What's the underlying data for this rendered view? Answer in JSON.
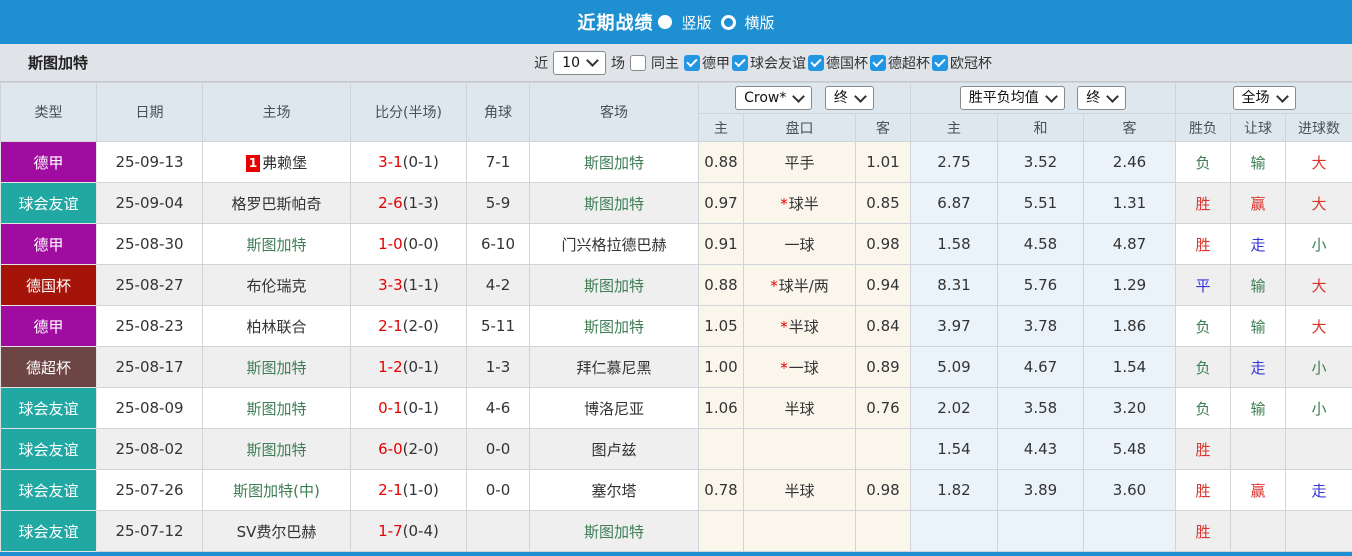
{
  "topbar": {
    "title": "近期战绩",
    "options": [
      {
        "label": "竖版",
        "selected": true
      },
      {
        "label": "横版",
        "selected": false
      }
    ]
  },
  "filterbar": {
    "team": "斯图加特",
    "near_label": "近",
    "count_value": "10",
    "games_label": "场",
    "same_venue": {
      "label": "同主",
      "checked": false
    },
    "leagues": [
      {
        "label": "德甲",
        "checked": true
      },
      {
        "label": "球会友谊",
        "checked": true
      },
      {
        "label": "德国杯",
        "checked": true
      },
      {
        "label": "德超杯",
        "checked": true
      },
      {
        "label": "欧冠杯",
        "checked": true
      }
    ]
  },
  "table": {
    "header": {
      "left": [
        "类型",
        "日期",
        "主场",
        "比分(半场)",
        "角球",
        "客场"
      ],
      "sub": [
        "主",
        "盘口",
        "客",
        "主",
        "和",
        "客",
        "胜负",
        "让球",
        "进球数"
      ]
    },
    "dropdowns": {
      "bookmaker": "Crow*",
      "final1": "终",
      "avg": "胜平负均值",
      "final2": "终",
      "scope": "全场"
    },
    "rows": [
      {
        "type": "德甲",
        "date": "25-09-13",
        "home": {
          "text": "弗赖堡",
          "self": false,
          "badge": "1"
        },
        "score": {
          "ft": "3-1",
          "ht": "(0-1)"
        },
        "corner": "7-1",
        "away": {
          "text": "斯图加特",
          "self": true
        },
        "odds": {
          "h": "0.88",
          "line": "平手",
          "star": false,
          "a": "1.01"
        },
        "avg": {
          "h": "2.75",
          "d": "3.52",
          "a": "2.46"
        },
        "res": [
          {
            "t": "负",
            "c": "green"
          },
          {
            "t": "输",
            "c": "green"
          },
          {
            "t": "大",
            "c": "red"
          }
        ]
      },
      {
        "type": "球会友谊",
        "date": "25-09-04",
        "home": {
          "text": "格罗巴斯帕奇",
          "self": false
        },
        "score": {
          "ft": "2-6",
          "ht": "(1-3)"
        },
        "corner": "5-9",
        "away": {
          "text": "斯图加特",
          "self": true
        },
        "odds": {
          "h": "0.97",
          "line": "球半",
          "star": true,
          "a": "0.85"
        },
        "avg": {
          "h": "6.87",
          "d": "5.51",
          "a": "1.31"
        },
        "res": [
          {
            "t": "胜",
            "c": "red"
          },
          {
            "t": "赢",
            "c": "red"
          },
          {
            "t": "大",
            "c": "red"
          }
        ]
      },
      {
        "type": "德甲",
        "date": "25-08-30",
        "home": {
          "text": "斯图加特",
          "self": true
        },
        "score": {
          "ft": "1-0",
          "ht": "(0-0)"
        },
        "corner": "6-10",
        "away": {
          "text": "门兴格拉德巴赫",
          "self": false
        },
        "odds": {
          "h": "0.91",
          "line": "一球",
          "star": false,
          "a": "0.98"
        },
        "avg": {
          "h": "1.58",
          "d": "4.58",
          "a": "4.87"
        },
        "res": [
          {
            "t": "胜",
            "c": "red"
          },
          {
            "t": "走",
            "c": "blue"
          },
          {
            "t": "小",
            "c": "green"
          }
        ]
      },
      {
        "type": "德国杯",
        "date": "25-08-27",
        "home": {
          "text": "布伦瑞克",
          "self": false
        },
        "score": {
          "ft": "3-3",
          "ht": "(1-1)"
        },
        "corner": "4-2",
        "away": {
          "text": "斯图加特",
          "self": true
        },
        "odds": {
          "h": "0.88",
          "line": "球半/两",
          "star": true,
          "a": "0.94"
        },
        "avg": {
          "h": "8.31",
          "d": "5.76",
          "a": "1.29"
        },
        "res": [
          {
            "t": "平",
            "c": "blue"
          },
          {
            "t": "输",
            "c": "green"
          },
          {
            "t": "大",
            "c": "red"
          }
        ]
      },
      {
        "type": "德甲",
        "date": "25-08-23",
        "home": {
          "text": "柏林联合",
          "self": false
        },
        "score": {
          "ft": "2-1",
          "ht": "(2-0)"
        },
        "corner": "5-11",
        "away": {
          "text": "斯图加特",
          "self": true
        },
        "odds": {
          "h": "1.05",
          "line": "半球",
          "star": true,
          "a": "0.84"
        },
        "avg": {
          "h": "3.97",
          "d": "3.78",
          "a": "1.86"
        },
        "res": [
          {
            "t": "负",
            "c": "green"
          },
          {
            "t": "输",
            "c": "green"
          },
          {
            "t": "大",
            "c": "red"
          }
        ]
      },
      {
        "type": "德超杯",
        "date": "25-08-17",
        "home": {
          "text": "斯图加特",
          "self": true
        },
        "score": {
          "ft": "1-2",
          "ht": "(0-1)"
        },
        "corner": "1-3",
        "away": {
          "text": "拜仁慕尼黑",
          "self": false
        },
        "odds": {
          "h": "1.00",
          "line": "一球",
          "star": true,
          "a": "0.89"
        },
        "avg": {
          "h": "5.09",
          "d": "4.67",
          "a": "1.54"
        },
        "res": [
          {
            "t": "负",
            "c": "green"
          },
          {
            "t": "走",
            "c": "blue"
          },
          {
            "t": "小",
            "c": "green"
          }
        ]
      },
      {
        "type": "球会友谊",
        "date": "25-08-09",
        "home": {
          "text": "斯图加特",
          "self": true
        },
        "score": {
          "ft": "0-1",
          "ht": "(0-1)"
        },
        "corner": "4-6",
        "away": {
          "text": "博洛尼亚",
          "self": false
        },
        "odds": {
          "h": "1.06",
          "line": "半球",
          "star": false,
          "a": "0.76"
        },
        "avg": {
          "h": "2.02",
          "d": "3.58",
          "a": "3.20"
        },
        "res": [
          {
            "t": "负",
            "c": "green"
          },
          {
            "t": "输",
            "c": "green"
          },
          {
            "t": "小",
            "c": "green"
          }
        ]
      },
      {
        "type": "球会友谊",
        "date": "25-08-02",
        "home": {
          "text": "斯图加特",
          "self": true
        },
        "score": {
          "ft": "6-0",
          "ht": "(2-0)"
        },
        "corner": "0-0",
        "away": {
          "text": "图卢兹",
          "self": false
        },
        "odds": {
          "h": "",
          "line": "",
          "star": false,
          "a": ""
        },
        "avg": {
          "h": "1.54",
          "d": "4.43",
          "a": "5.48"
        },
        "res": [
          {
            "t": "胜",
            "c": "red"
          },
          {
            "t": "",
            "c": ""
          },
          {
            "t": "",
            "c": ""
          }
        ]
      },
      {
        "type": "球会友谊",
        "date": "25-07-26",
        "home": {
          "text": "斯图加特(中)",
          "self": true
        },
        "score": {
          "ft": "2-1",
          "ht": "(1-0)"
        },
        "corner": "0-0",
        "away": {
          "text": "塞尔塔",
          "self": false
        },
        "odds": {
          "h": "0.78",
          "line": "半球",
          "star": false,
          "a": "0.98"
        },
        "avg": {
          "h": "1.82",
          "d": "3.89",
          "a": "3.60"
        },
        "res": [
          {
            "t": "胜",
            "c": "red"
          },
          {
            "t": "赢",
            "c": "red"
          },
          {
            "t": "走",
            "c": "blue"
          }
        ]
      },
      {
        "type": "球会友谊",
        "date": "25-07-12",
        "home": {
          "text": "SV费尔巴赫",
          "self": false
        },
        "score": {
          "ft": "1-7",
          "ht": "(0-4)"
        },
        "corner": "",
        "away": {
          "text": "斯图加特",
          "self": true
        },
        "odds": {
          "h": "",
          "line": "",
          "star": false,
          "a": ""
        },
        "avg": {
          "h": "",
          "d": "",
          "a": ""
        },
        "res": [
          {
            "t": "胜",
            "c": "red"
          },
          {
            "t": "",
            "c": ""
          },
          {
            "t": "",
            "c": ""
          }
        ]
      }
    ]
  },
  "colors": {
    "league": {
      "德甲": "#A00CA0",
      "球会友谊": "#21A8A2",
      "德国杯": "#A51408",
      "德超杯": "#6E4545"
    },
    "outcome": {
      "red": "#D9342C",
      "green": "#3E7E53",
      "blue": "#3434D6"
    },
    "score_red": "#E60000",
    "self_green": "#3F7E55",
    "accent_blue": "#1E8FD0"
  }
}
